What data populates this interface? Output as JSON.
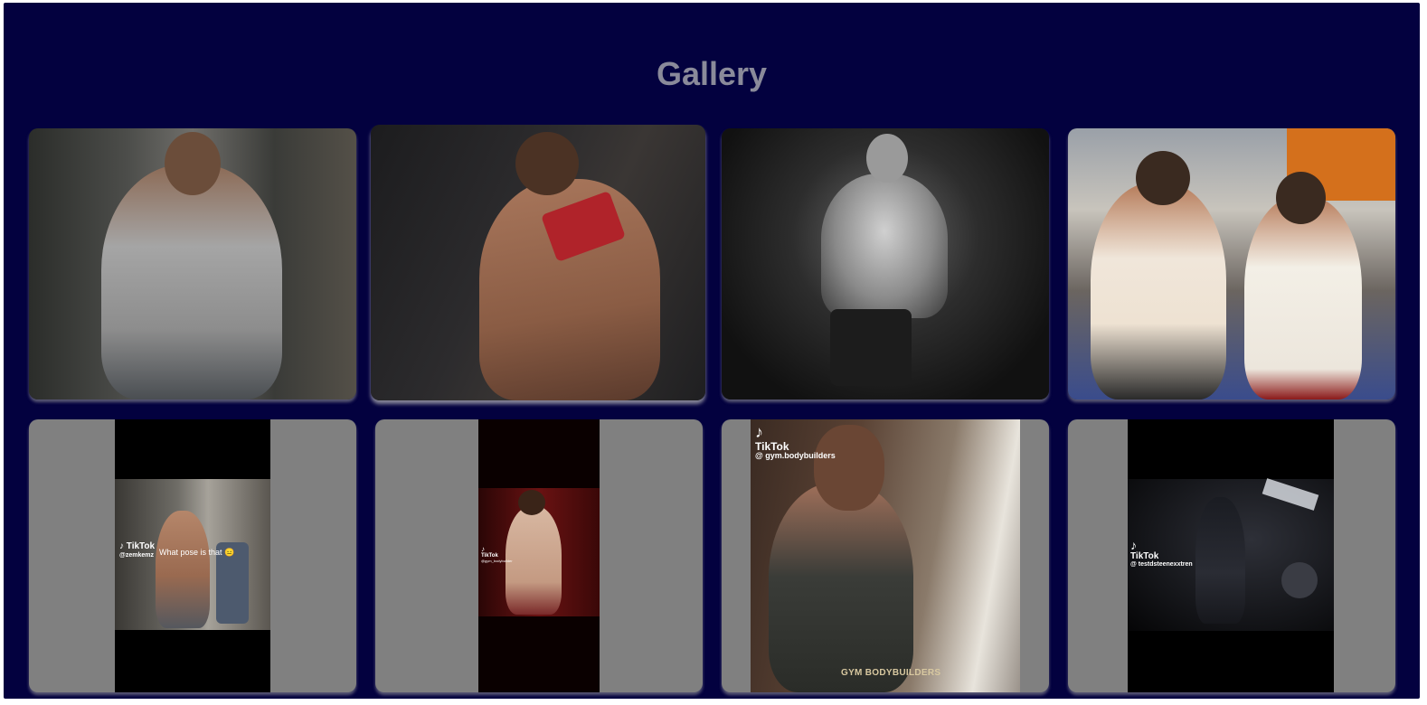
{
  "page": {
    "title": "Gallery",
    "background": "#03013f",
    "title_color": "#8a8a9a",
    "card_color": "#808080"
  },
  "gallery": {
    "photos": [
      {
        "name": "photo-bodybuilder-tanktop"
      },
      {
        "name": "photo-mirror-selfie-red-towel"
      },
      {
        "name": "photo-bodybuilder-pose-bw"
      },
      {
        "name": "photo-two-men-gym-selfie"
      }
    ],
    "videos": [
      {
        "tiktok_logo": "TikTok",
        "handle": "@zemkemz",
        "caption": "What pose is that 😑"
      },
      {
        "tiktok_logo": "TikTok",
        "handle": "@gym_bodybuilder"
      },
      {
        "tiktok_logo": "TikTok",
        "handle": "@ gym.bodybuilders",
        "watermark": "GYM BODYBUILDERS"
      },
      {
        "tiktok_logo": "TikTok",
        "handle": "@ testdsteenexxtren"
      }
    ]
  }
}
